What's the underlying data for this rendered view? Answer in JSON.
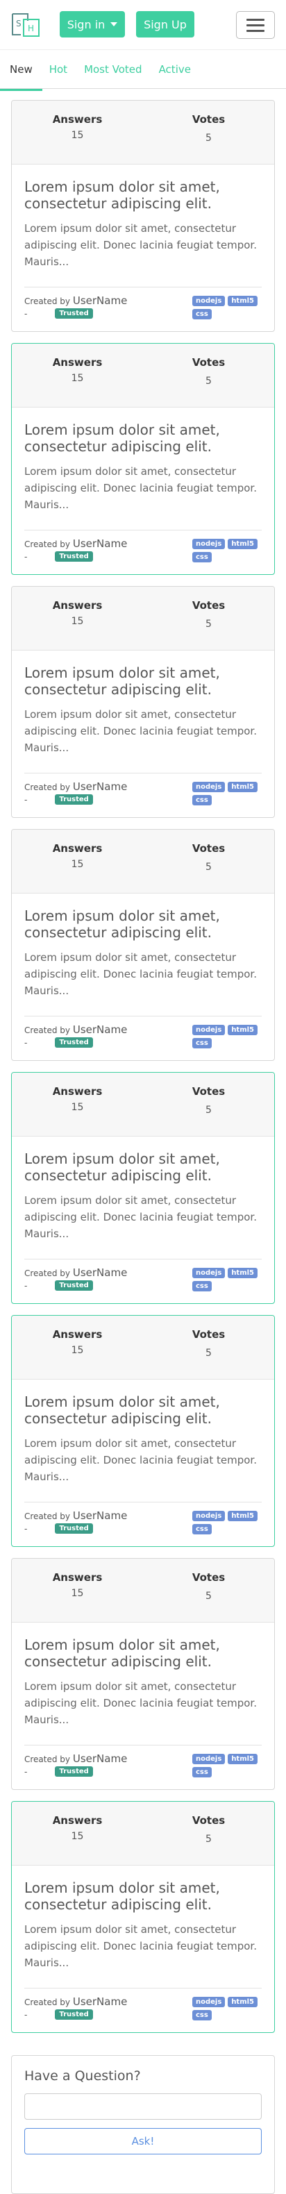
{
  "navbar": {
    "signin_label": "Sign in",
    "signup_label": "Sign Up"
  },
  "tabs": [
    {
      "label": "New"
    },
    {
      "label": "Hot"
    },
    {
      "label": "Most Voted"
    },
    {
      "label": "Active"
    }
  ],
  "card": {
    "answers_label": "Answers",
    "answers_value": "15",
    "votes_label": "Votes",
    "votes_value": "5",
    "title": "Lorem ipsum dolor sit amet, consectetur adipiscing elit.",
    "text": "Lorem ipsum dolor sit amet, consectetur adipiscing elit. Donec lacinia feugiat tempor. Mauris...",
    "created_by": "Created by",
    "username": "UserName",
    "dash": "-",
    "trusted": "Trusted",
    "tags": [
      "nodejs",
      "html5",
      "css"
    ]
  },
  "cards_highlight": [
    false,
    true,
    false,
    false,
    true,
    true,
    false,
    true
  ],
  "ask": {
    "title": "Have a Question?",
    "button": "Ask!"
  }
}
